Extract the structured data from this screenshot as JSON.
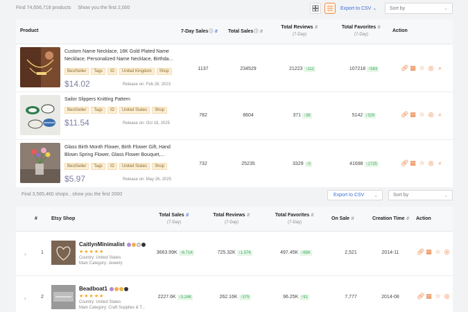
{
  "top": {
    "found_text": "Find 74,656,718 products",
    "show_text": "Show you the first 2,000",
    "export_label": "Export to CSV",
    "sort_label": "Sort by"
  },
  "products_table": {
    "headers": {
      "product": "Product",
      "sales7": "7-Day Sales",
      "total_sales": "Total Sales",
      "total_reviews": "Total Reviews",
      "total_reviews_sub": "(7-Day)",
      "total_favorites": "Total Favorites",
      "total_favorites_sub": "(7-Day)",
      "action": "Action"
    },
    "rows": [
      {
        "title": "Custom Name Necklace, 18K Gold Plated Name Necklace, Personalized Name Necklace, Birthda...",
        "tags": [
          "BestSeller",
          "Tags",
          "ID",
          "United Kingdom",
          "Shop"
        ],
        "price": "$14.02",
        "release": "Release on: Feb 28, 2023",
        "sales7": "1137",
        "total_sales": "234529",
        "reviews": "21223",
        "reviews_delta": "↑112",
        "favorites": "107218",
        "favorites_delta": "↑583"
      },
      {
        "title": "Sailor Slippers Knitting Pattern",
        "tags": [
          "BestSeller",
          "Tags",
          "ID",
          "United States",
          "Shop"
        ],
        "price": "$11.54",
        "release": "Release on: Oct 18, 2025",
        "sales7": "782",
        "total_sales": "8604",
        "reviews": "371",
        "reviews_delta": "↑36",
        "favorites": "5142",
        "favorites_delta": "↑329"
      },
      {
        "title": "Glass Birth Month Flower, Birth Flower Gift, Hand Blown Spring Flower, Glass Flower Bouquet,...",
        "tags": [
          "BestSeller",
          "Tags",
          "ID",
          "United States",
          "Shop"
        ],
        "price": "$5.97",
        "release": "Release on: May 26, 2025",
        "sales7": "732",
        "total_sales": "25235",
        "reviews": "3329",
        "reviews_delta": "↑0",
        "favorites": "41698",
        "favorites_delta": "↑1725"
      }
    ]
  },
  "shops_bar": {
    "found_text": "Find 3,565,460 shops , show you the first 2000",
    "export_label": "Export to CSV",
    "sort_label": "Sort by"
  },
  "shops_table": {
    "headers": {
      "index": "#",
      "shop": "Etsy Shop",
      "total_sales": "Total Sales",
      "total_sales_sub": "(7-Day)",
      "total_reviews": "Total Reviews",
      "total_reviews_sub": "(7-Day)",
      "total_favorites": "Total Favorites",
      "total_favorites_sub": "(7-Day)",
      "on_sale": "On Sale",
      "creation_time": "Creation Time",
      "action": "Action"
    },
    "rows": [
      {
        "index": "1",
        "name": "CaitlynMinimalist",
        "stars": "★★★★★",
        "country": "Country: United States",
        "category": "Main Category: Jewelry",
        "total_sales": "3663.99K",
        "sales_delta": "↑6.71K",
        "reviews": "725.32K",
        "reviews_delta": "↑1.57K",
        "favorites": "497.45K",
        "favorites_delta": "↑65K",
        "on_sale": "2,521",
        "creation": "2014-11"
      },
      {
        "index": "2",
        "name": "Beadboat1",
        "stars": "★★★★★",
        "country": "Country: United States",
        "category": "Main Category: Craft Supplies & T...",
        "total_sales": "2227.6K",
        "sales_delta": "↑3.24K",
        "reviews": "262.16K",
        "reviews_delta": "↑375",
        "favorites": "96.25K",
        "favorites_delta": "↑91",
        "on_sale": "7,777",
        "creation": "2014-08"
      }
    ]
  },
  "icons": {
    "link": "link-icon",
    "calendar": "calendar-icon",
    "star": "star-icon",
    "target": "target-icon",
    "search": "search-icon"
  },
  "colors": {
    "accent_orange": "#e87b3a",
    "link_blue": "#3b6fd8",
    "price": "#7a7fa0",
    "delta_green": "#3aa75a"
  }
}
